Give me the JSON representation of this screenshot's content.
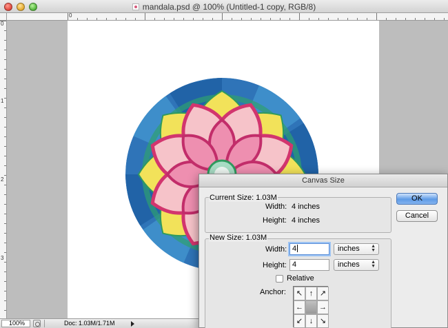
{
  "window": {
    "title": "mandala.psd @ 100% (Untitled-1 copy, RGB/8)",
    "icon": "psd-file-icon"
  },
  "rulers": {
    "top_labels": [
      "0"
    ],
    "left_labels": [
      "0",
      "1",
      "2",
      "3"
    ]
  },
  "statusbar": {
    "zoom": "100%",
    "doc_info": "Doc: 1.03M/1.71M"
  },
  "dialog": {
    "title": "Canvas Size",
    "current_size": {
      "heading": "Current Size: 1.03M",
      "width_label": "Width:",
      "width_value": "4 inches",
      "height_label": "Height:",
      "height_value": "4 inches"
    },
    "new_size": {
      "heading": "New Size: 1.03M",
      "width_label": "Width:",
      "width_value": "4",
      "width_unit": "inches",
      "height_label": "Height:",
      "height_value": "4",
      "height_unit": "inches",
      "relative_label": "Relative",
      "relative_checked": false,
      "anchor_label": "Anchor:",
      "anchor_arrows": [
        "↖",
        "↑",
        "↗",
        "←",
        "",
        "→",
        "↙",
        "↓",
        "↘"
      ]
    },
    "ok_label": "OK",
    "cancel_label": "Cancel"
  },
  "colors": {
    "pasteboard": "#bdbdbd",
    "canvas": "#ffffff",
    "accent": "#5f9be6"
  }
}
